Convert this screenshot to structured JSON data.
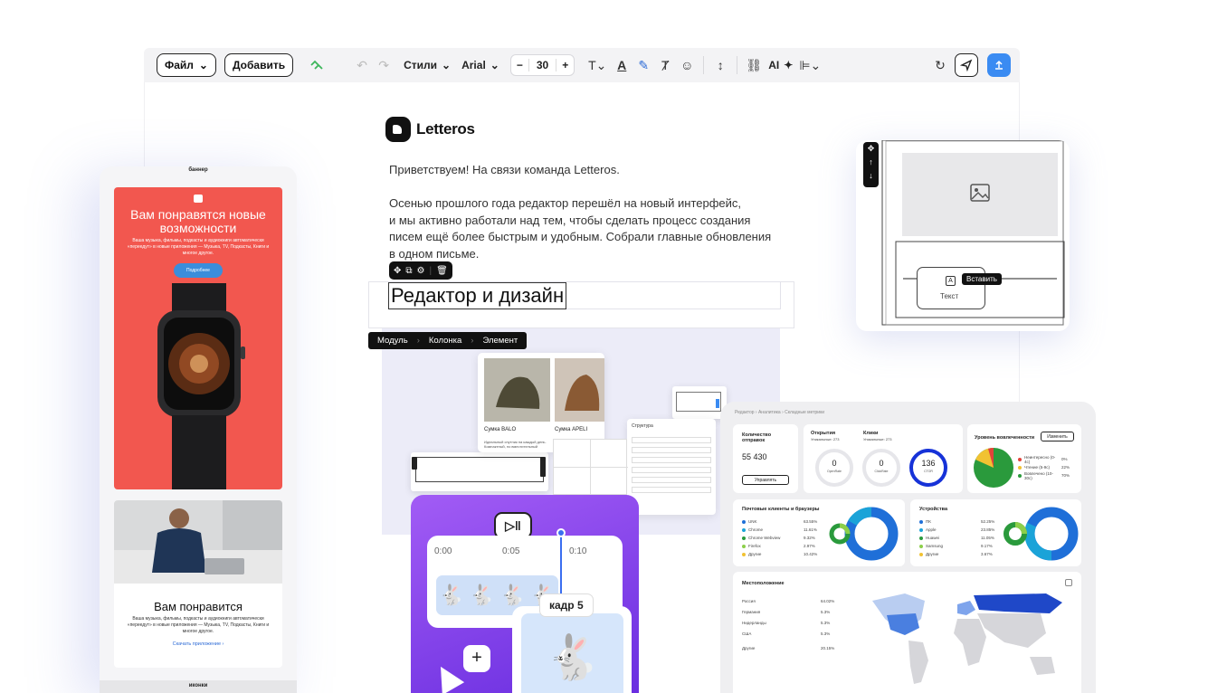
{
  "toolbar": {
    "file_label": "Файл",
    "add_label": "Добавить",
    "styles_label": "Стили",
    "font_label": "Arial",
    "font_size": "30",
    "minus": "−",
    "plus": "+",
    "ai_label": "AI"
  },
  "email": {
    "brand": "Letteros",
    "greeting": "Приветствуем! На связи команда Letteros.",
    "paragraph": [
      "Осенью прошлого года редактор перешёл на новый интерфейс,",
      "и мы активно работали над тем, чтобы сделать процесс создания",
      "писем ещё более быстрым и удобным. Собрали главные обновления",
      "в одном письме."
    ],
    "heading": "Редактор и дизайн",
    "breadcrumbs": [
      "Модуль",
      "Колонка",
      "Элемент"
    ]
  },
  "phone": {
    "top_label": "баннер",
    "banner_title": "Вам понравятся новые возможности",
    "banner_text": "Ваша музыка, фильмы, подкасты и аудиокниги автоматически «переедут» в новые приложения — Музыка, TV, Подкасты, Книги и многое другое.",
    "banner_button": "Подробнее",
    "card_title": "Вам понравится",
    "card_text": "Ваша музыка, фильмы, подкасты и аудиокниги автоматически «переедут» в новые приложения — Музыка, TV, Подкасты, Книги и многое другое.",
    "card_link": "Скачать приложение ›",
    "bottom_label": "иконки"
  },
  "image_panel": {
    "insert_label": "Вставить",
    "text_label": "Текст"
  },
  "products": {
    "item1": "Сумка BALO",
    "item2": "Сумка APELI",
    "desc": "Идеальный спутник на каждый день. Компактный, но вместительный",
    "structure": "Структура"
  },
  "animation": {
    "t0": "0:00",
    "t1": "0:05",
    "t2": "0:10",
    "frame": "кадр 5",
    "add": "+"
  },
  "analytics": {
    "breadcrumb": "Редактор  ›  Аналитика  ›  Складные метрики",
    "sent_label": "Количество отправок",
    "sent_value": "55 430",
    "manage": "Управлять",
    "opens_label": "Открытия",
    "opens_sub": "Уникальные: 273",
    "clicks_label": "Клики",
    "clicks_sub": "Уникальные: 273",
    "opens_val": "0",
    "opens_rate": "OpenRate",
    "clicks_val": "0",
    "clicks_rate": "ClickRate",
    "ctor_val": "136",
    "ctor_rate": "CTOR",
    "engagement": "Уровень вовлеченности",
    "change": "Изменить",
    "eng_legend": [
      {
        "label": "Неинтересно (0-4с)",
        "value": "0%"
      },
      {
        "label": "Чтение (5-9с)",
        "value": "22%"
      },
      {
        "label": "Вовлечено (10-30с)",
        "value": "70%"
      }
    ],
    "clients_title": "Почтовые клиенты и браузеры",
    "clients": [
      {
        "label": "UNK",
        "value": "63.55%"
      },
      {
        "label": "Chrome",
        "value": "11.61%"
      },
      {
        "label": "Chrome Webview",
        "value": "9.32%"
      },
      {
        "label": "Firefox",
        "value": "2.97%"
      },
      {
        "label": "Другие",
        "value": "10.42%"
      }
    ],
    "devices_title": "Устройства",
    "devices": [
      {
        "label": "ПК",
        "value": "52.25%"
      },
      {
        "label": "Apple",
        "value": "23.85%"
      },
      {
        "label": "Huawei",
        "value": "11.05%"
      },
      {
        "label": "Samsung",
        "value": "9.17%"
      },
      {
        "label": "Другие",
        "value": "3.67%"
      }
    ],
    "geo_title": "Местоположение",
    "geo": [
      {
        "label": "Россия",
        "value": "64.02%"
      },
      {
        "label": "Германия",
        "value": "5.3%"
      },
      {
        "label": "Нидерланды",
        "value": "5.3%"
      },
      {
        "label": "США",
        "value": "5.3%"
      },
      {
        "label": "Другие",
        "value": "20.15%"
      }
    ]
  }
}
